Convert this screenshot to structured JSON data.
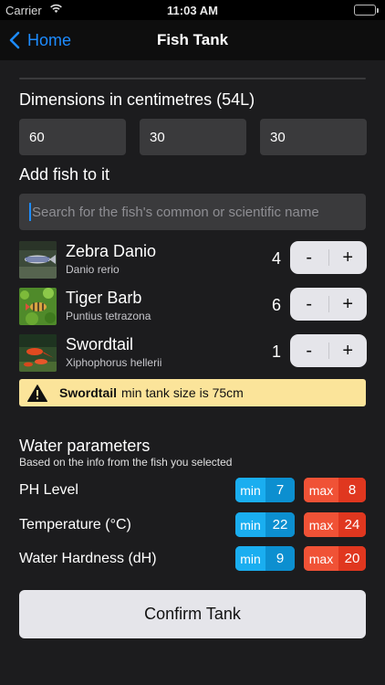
{
  "status_bar": {
    "carrier": "Carrier",
    "time": "11:03 AM"
  },
  "nav": {
    "back_label": "Home",
    "title": "Fish Tank"
  },
  "dimensions": {
    "title": "Dimensions in centimetres (54L)",
    "values": [
      "60",
      "30",
      "30"
    ]
  },
  "add_fish": {
    "title": "Add fish to it",
    "search_placeholder": "Search for the fish's common or scientific name"
  },
  "fish": [
    {
      "name": "Zebra Danio",
      "scientific": "Danio rerio",
      "count": "4",
      "thumb": "zebra-danio"
    },
    {
      "name": "Tiger Barb",
      "scientific": "Puntius tetrazona",
      "count": "6",
      "thumb": "tiger-barb"
    },
    {
      "name": "Swordtail",
      "scientific": "Xiphophorus hellerii",
      "count": "1",
      "thumb": "swordtail"
    }
  ],
  "stepper": {
    "minus": "-",
    "plus": "+"
  },
  "warning": {
    "fish": "Swordtail",
    "text": "min tank size is 75cm"
  },
  "water": {
    "title": "Water parameters",
    "subtitle": "Based on the info from the fish you selected",
    "min_label": "min",
    "max_label": "max",
    "params": [
      {
        "label": "PH Level",
        "min": "7",
        "max": "8"
      },
      {
        "label": "Temperature (°C)",
        "min": "22",
        "max": "24"
      },
      {
        "label": "Water Hardness (dH)",
        "min": "9",
        "max": "20"
      }
    ]
  },
  "confirm_label": "Confirm Tank",
  "colors": {
    "background": "#1c1c1e",
    "accent": "#1d8cff",
    "min_pill": "#0aa3e6",
    "max_pill": "#f0452e",
    "warning": "#fbe49a"
  }
}
